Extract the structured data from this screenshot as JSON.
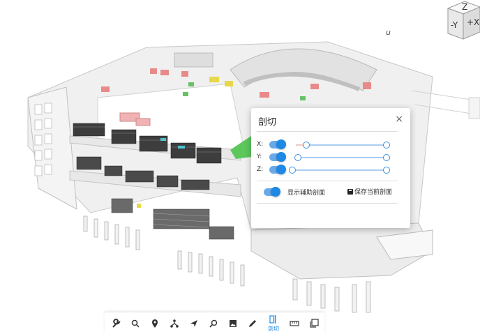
{
  "viewer": {
    "coord_label": "u",
    "nav_cube": {
      "top_label": "Z",
      "front_label": "-Y",
      "side_label": "+X"
    }
  },
  "section_panel": {
    "title": "剖切",
    "close_glyph": "×",
    "axes": [
      {
        "label": "X:",
        "enabled": true
      },
      {
        "label": "Y:",
        "enabled": true
      },
      {
        "label": "Z:",
        "enabled": true
      }
    ],
    "show_aux_section": {
      "label": "显示辅助剖面",
      "enabled": true
    },
    "save_button": "保存当前剖面"
  },
  "toolbar": {
    "active_tool": "section",
    "active_label": "剖切",
    "tools": [
      "wrench-icon",
      "search-icon",
      "location-pin-icon",
      "network-icon",
      "navigate-arrow-icon",
      "zoom-fit-icon",
      "image-icon",
      "pen-icon",
      "section-icon",
      "ruler-icon",
      "layers-icon"
    ]
  },
  "colors": {
    "accent": "#1e88e5",
    "track": "#a9cdf1"
  }
}
